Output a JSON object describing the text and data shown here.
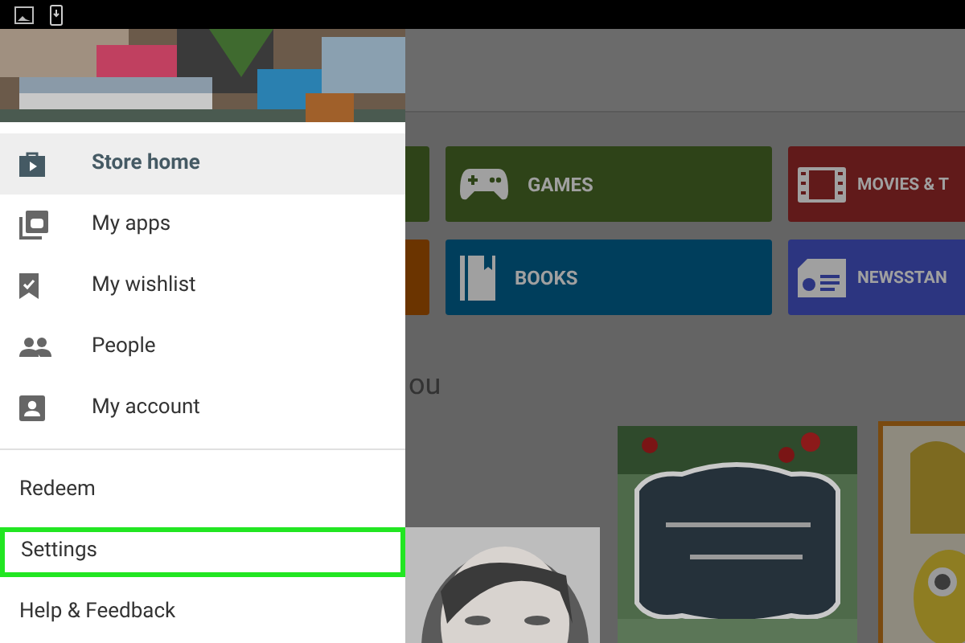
{
  "drawer": {
    "items": [
      {
        "label": "Store home",
        "selected": true
      },
      {
        "label": "My apps",
        "selected": false
      },
      {
        "label": "My wishlist",
        "selected": false
      },
      {
        "label": "People",
        "selected": false
      },
      {
        "label": "My account",
        "selected": false
      }
    ],
    "links": [
      {
        "label": "Redeem",
        "highlighted": false
      },
      {
        "label": "Settings",
        "highlighted": true
      },
      {
        "label": "Help & Feedback",
        "highlighted": false
      }
    ]
  },
  "categories": [
    {
      "color": "#2e4318"
    },
    {
      "label": "GAMES",
      "color": "#2e4318"
    },
    {
      "label": "MOVIES & T",
      "color": "#611a1a"
    },
    {
      "color": "#6b3400"
    },
    {
      "label": "BOOKS",
      "color": "#003e5c"
    },
    {
      "label": "NEWSSTAN",
      "color": "#2c3580"
    }
  ],
  "section_title": "ou"
}
